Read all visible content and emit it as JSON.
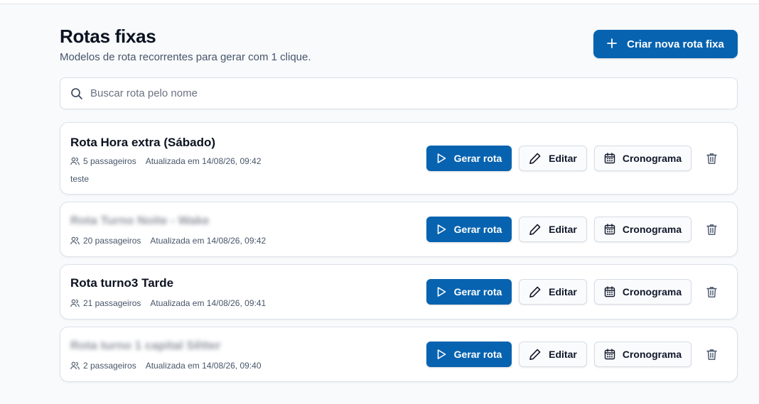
{
  "header": {
    "title": "Rotas fixas",
    "subtitle": "Modelos de rota recorrentes para gerar com 1 clique.",
    "create_label": "Criar nova rota fixa"
  },
  "search": {
    "placeholder": "Buscar rota pelo nome",
    "value": ""
  },
  "actions": {
    "generate_label": "Gerar rota",
    "edit_label": "Editar",
    "schedule_label": "Cronograma"
  },
  "routes": [
    {
      "name": "Rota Hora extra (Sábado)",
      "blurred": false,
      "passengers": "5 passageiros",
      "updated": "Atualizada em 14/08/26, 09:42",
      "note": "teste"
    },
    {
      "name": "Rota Turno Noite - Wake",
      "blurred": true,
      "passengers": "20 passageiros",
      "updated": "Atualizada em 14/08/26, 09:42",
      "note": ""
    },
    {
      "name": "Rota turno3 Tarde",
      "blurred": false,
      "passengers": "21 passageiros",
      "updated": "Atualizada em 14/08/26, 09:41",
      "note": ""
    },
    {
      "name": "Rota turno 1 capital Sêtter",
      "blurred": true,
      "passengers": "2 passageiros",
      "updated": "Atualizada em 14/08/26, 09:40",
      "note": ""
    }
  ],
  "colors": {
    "primary": "#0763b0",
    "background": "#f8fafc",
    "card": "#ffffff",
    "muted_text": "#475569"
  },
  "icons": {
    "search": "search-icon",
    "plus": "plus-icon",
    "play": "play-icon",
    "pencil": "pencil-icon",
    "calendar": "calendar-icon",
    "trash": "trash-icon",
    "users": "users-icon"
  }
}
